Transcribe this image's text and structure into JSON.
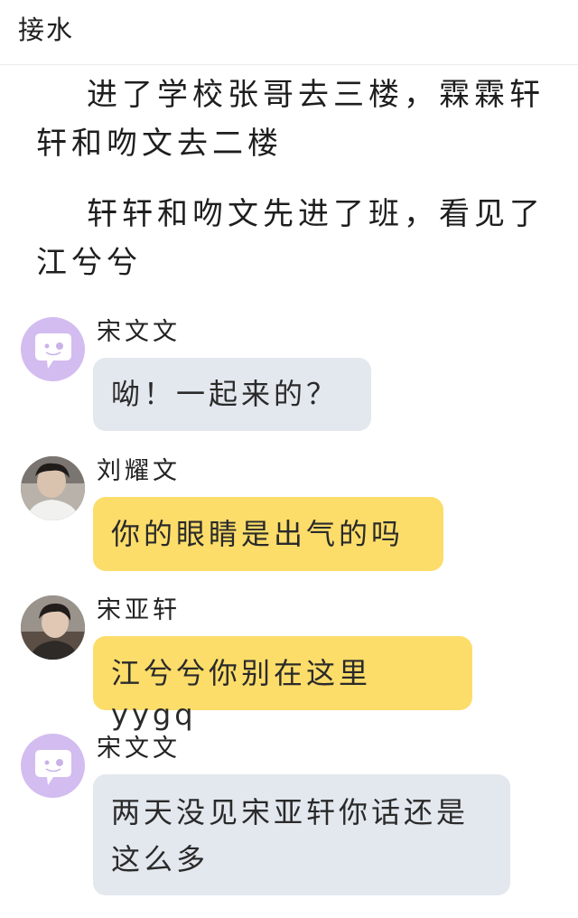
{
  "header": {
    "title": "接水"
  },
  "narration": [
    "进了学校张哥去三楼，霖霖轩轩和吻文去二楼",
    "轩轩和吻文先进了班，看见了江兮兮"
  ],
  "messages": [
    {
      "sender": "宋文文",
      "text": "呦！一起来的？",
      "bubble_color": "#e3e7ee",
      "avatar": "chat-bubble-placeholder-icon"
    },
    {
      "sender": "刘耀文",
      "text": "你的眼睛是出气的吗",
      "bubble_color": "#fcdd6a",
      "avatar": "user-photo"
    },
    {
      "sender": "宋亚轩",
      "text": "江兮兮你别在这里yygq",
      "bubble_color": "#fcdd6a",
      "avatar": "user-photo"
    },
    {
      "sender": "宋文文",
      "text": "两天没见宋亚轩你话还是这么多",
      "bubble_color": "#e3e7ee",
      "avatar": "chat-bubble-placeholder-icon"
    }
  ]
}
